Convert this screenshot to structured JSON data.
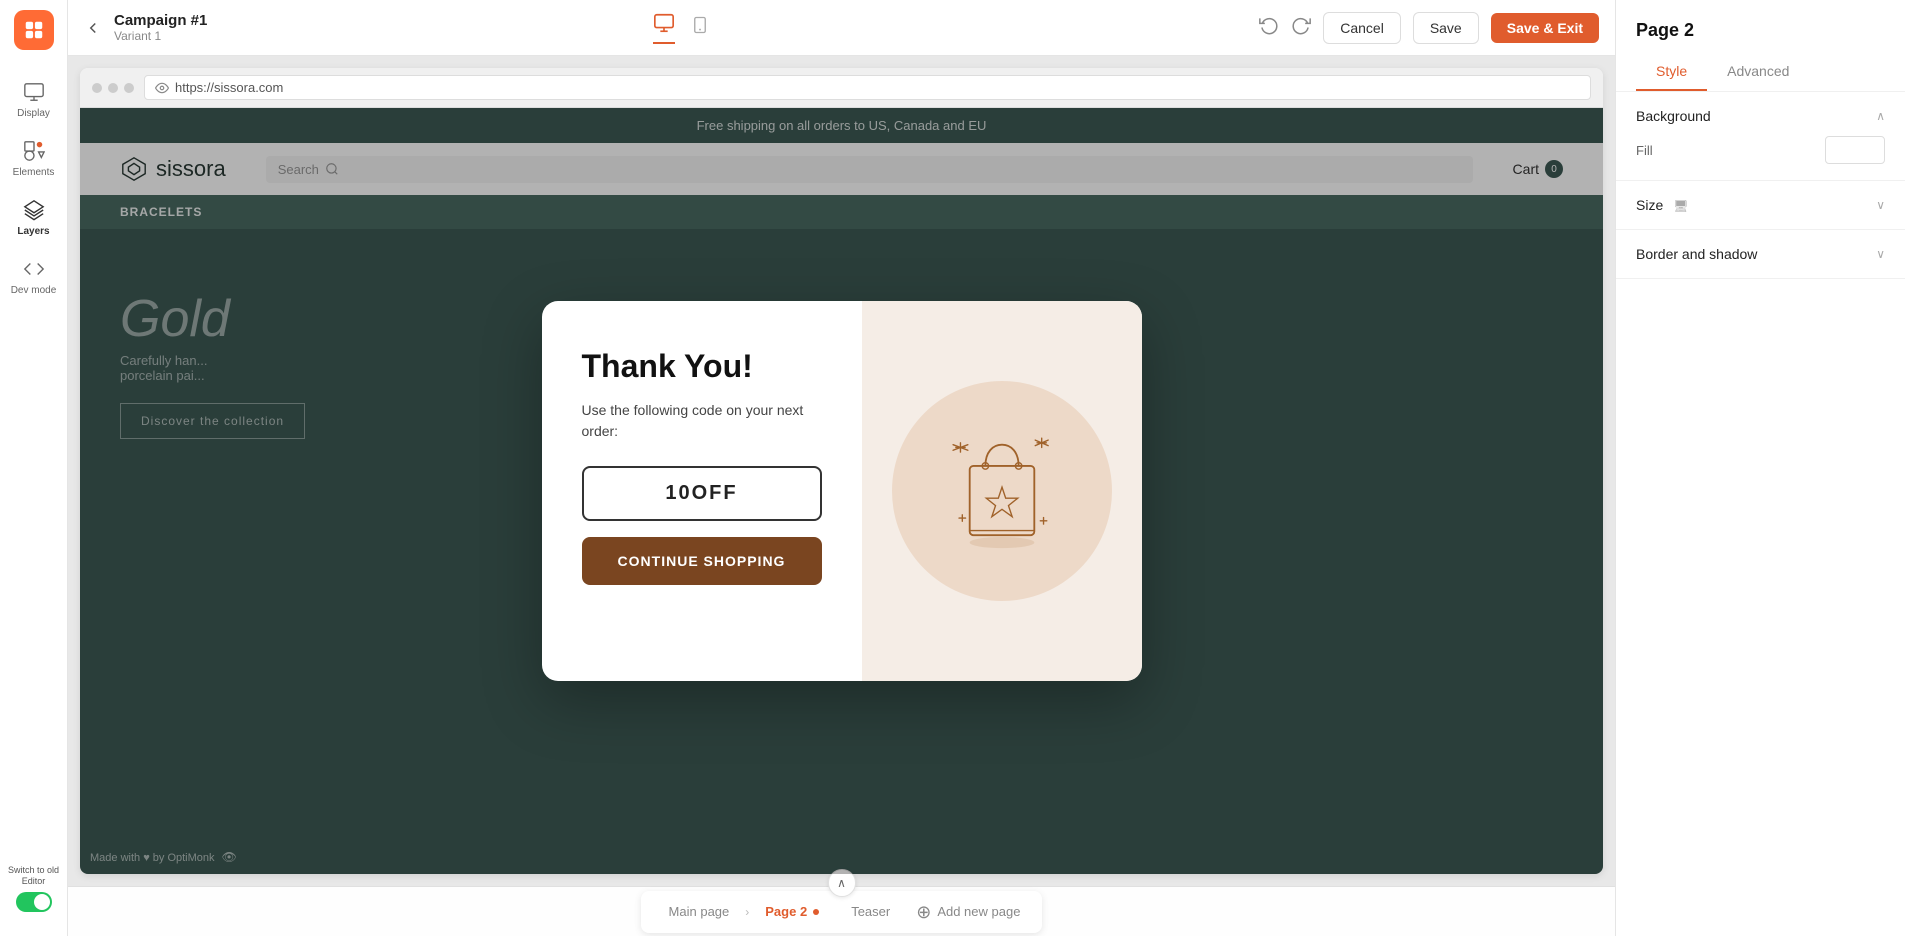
{
  "app": {
    "logo_label": "OptiMonk",
    "campaign_title": "Campaign #1",
    "campaign_variant": "Variant 1"
  },
  "topbar": {
    "back_label": "‹",
    "undo_label": "↺",
    "redo_label": "↻",
    "cancel_label": "Cancel",
    "save_label": "Save",
    "save_exit_label": "Save & Exit",
    "device_desktop": "🖥",
    "device_mobile": "📱"
  },
  "sidebar": {
    "display_label": "Display",
    "elements_label": "Elements",
    "layers_label": "Layers",
    "devmode_label": "Dev mode",
    "switch_label": "Switch to old Editor"
  },
  "browser": {
    "url": "https://sissora.com"
  },
  "website": {
    "banner_text": "Free shipping on all orders to US, Canada and EU",
    "logo_text": "sissora",
    "search_placeholder": "Search",
    "cart_label": "Cart",
    "cart_count": "0",
    "nav_links": [
      "BRACELETS"
    ],
    "hero_title": "Gold",
    "hero_subtitle": "Carefully han... porcelain pai...",
    "discover_btn": "Discover the collection"
  },
  "popup": {
    "title": "Thank You!",
    "description": "Use the following code on\nyour next order:",
    "code": "10OFF",
    "cta_label": "CONTINUE SHOPPING",
    "close_label": "×"
  },
  "pages_bar": {
    "up_arrow": "∧",
    "main_page_label": "Main page",
    "page2_label": "Page 2",
    "teaser_label": "Teaser",
    "add_page_label": "Add new page",
    "arrow_right": "›"
  },
  "right_panel": {
    "title": "Page 2",
    "tab_style": "Style",
    "tab_advanced": "Advanced",
    "background_label": "Background",
    "fill_label": "Fill",
    "size_label": "Size",
    "border_shadow_label": "Border and shadow",
    "chevron_up": "∧",
    "chevron_down": "∨",
    "size_icon": "⬜"
  },
  "footer": {
    "made_with_label": "Made with ♥ by OptiMonk"
  }
}
